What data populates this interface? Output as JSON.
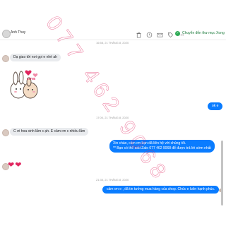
{
  "header": {
    "contact_name": "Anh Thuy",
    "move_label": "Chuyển đến thư mục Xong",
    "icons": [
      "trash-icon",
      "clock-icon",
      "mail-icon",
      "tag-icon",
      "more-icon"
    ]
  },
  "timestamps": {
    "t1": "16:58, 21 THÁNG 8, 2020",
    "t2": "17:00, 21 THÁNG 8, 2020",
    "t3": "21:35, 21 THÁNG 8, 2020"
  },
  "messages": {
    "m1": "Dạ giao tới nơi gọi e nhé ah",
    "m2": "ok e",
    "m3": "C ơi hoa xinh lắm c ạh. E cảm ơn c nhiều lắm",
    "m4_line1": "Xin chào, cảm ơn bạn đã liên hệ với chúng tôi.",
    "m4_line2": "** Bạn có thể add Zalo 077 462 9068 để được trả lời sớm nhất",
    "m5": "cảm ơn e , đã tin tưởng mua hàng của shop. Chúc e luôn hạnh phúc."
  },
  "sticker": {
    "label": "LOVE"
  },
  "reactions": {
    "hearts": [
      "❤",
      "❤"
    ]
  },
  "watermark": {
    "text": "077 462 9068",
    "color": "#e0245e"
  },
  "colors": {
    "outgoing": "#0a7cff",
    "incoming": "#e9ebee",
    "move_check": "#2eaa55"
  }
}
